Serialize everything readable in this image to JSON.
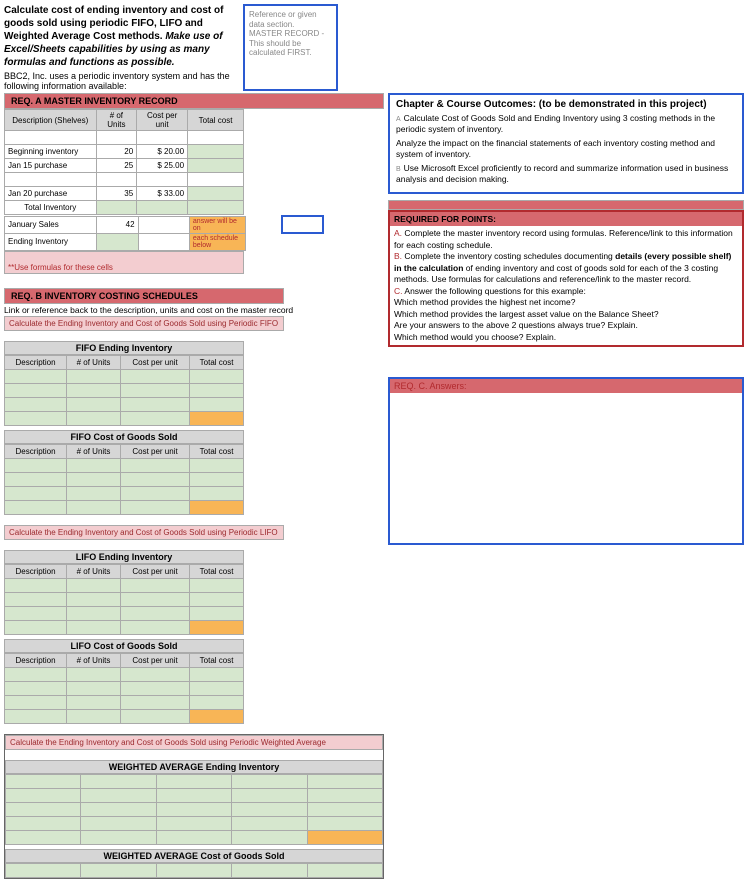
{
  "instructions": {
    "title_line1": "Calculate cost of ending inventory and cost of goods sold using periodic FIFO, LIFO and Weighted Average Cost methods.",
    "title_italic": "Make use of Excel/Sheets capabilities by using as many formulas and functions as possible.",
    "sub": "BBC2, Inc. uses a periodic inventory system and has the following information available:"
  },
  "refbox": {
    "l1": "Reference or given data section.",
    "l2": "MASTER RECORD - This should be calculated FIRST."
  },
  "reqA": {
    "header": "REQ. A     MASTER INVENTORY RECORD",
    "cols": {
      "desc": "Description (Shelves)",
      "units": "# of Units",
      "cost": "Cost per unit",
      "total": "Total cost"
    },
    "rows": {
      "begin": {
        "desc": "Beginning inventory",
        "units": "20",
        "cost": "$     20.00"
      },
      "jan15": {
        "desc": "Jan 15 purchase",
        "units": "25",
        "cost": "$     25.00"
      },
      "jan20": {
        "desc": "Jan 20 purchase",
        "units": "35",
        "cost": "$     33.00"
      },
      "totInv": {
        "desc": "Total Inventory"
      },
      "janSales": {
        "desc": "January Sales",
        "units": "42",
        "note": "answer will be on"
      },
      "endInv": {
        "desc": "Ending Inventory",
        "note": "each schedule below"
      }
    },
    "footnote": "**Use formulas for these cells"
  },
  "reqB": {
    "header": "REQ. B     INVENTORY COSTING SCHEDULES",
    "sub": "Link or reference back to the description, units and cost on the master record",
    "fifo_calc": "Calculate the Ending Inventory and Cost of Goods Sold using Periodic FIFO",
    "fifo_end": "FIFO Ending Inventory",
    "fifo_cogs": "FIFO Cost of Goods Sold",
    "lifo_calc": "Calculate the Ending Inventory and Cost of Goods Sold using Periodic LIFO",
    "lifo_end": "LIFO Ending Inventory",
    "lifo_cogs": "LIFO Cost of Goods Sold",
    "wavg_calc": "Calculate the Ending Inventory and Cost of Goods Sold using Periodic Weighted Average",
    "wavg_end": "WEIGHTED AVERAGE Ending Inventory",
    "wavg_cogs": "WEIGHTED AVERAGE Cost of Goods Sold",
    "cols": {
      "desc": "Description",
      "units": "# of Units",
      "cost": "Cost per unit",
      "total": "Total cost"
    }
  },
  "outcomes": {
    "heading": "Chapter & Course Outcomes: (to be demonstrated in this project)",
    "p1": "Calculate Cost of Goods Sold and Ending Inventory using 3 costing methods in the periodic system of inventory.",
    "p2": "Analyze the impact on the financial statements of each inventory costing method and system of inventory.",
    "p3": "Use Microsoft Excel proficiently to record and summarize information used in business analysis and decision making.",
    "ptrA": "A",
    "ptrB": "B"
  },
  "reqpoints": {
    "header": "REQUIRED FOR POINTS:",
    "A": "Complete the master inventory record using formulas. Reference/link to this information for each costing schedule.",
    "B1": "Complete the inventory costing schedules documenting ",
    "Bbold": "details (every possible shelf) in the calculation",
    "B2": " of ending inventory and cost of goods sold for each of the 3 costing methods. Use formulas for calculations and reference/link to the master record.",
    "C": "Answer the following questions for this example:",
    "q1": "Which method provides the highest net income?",
    "q2": "Which method provides the largest asset value on the Balance Sheet?",
    "q3": "Are your answers to the above 2 questions always true?  Explain.",
    "q4": "Which method would you choose?  Explain.",
    "lblA": "A.",
    "lblB": "B.",
    "lblC": "C."
  },
  "answers": {
    "header": "REQ.  C.    Answers:"
  }
}
